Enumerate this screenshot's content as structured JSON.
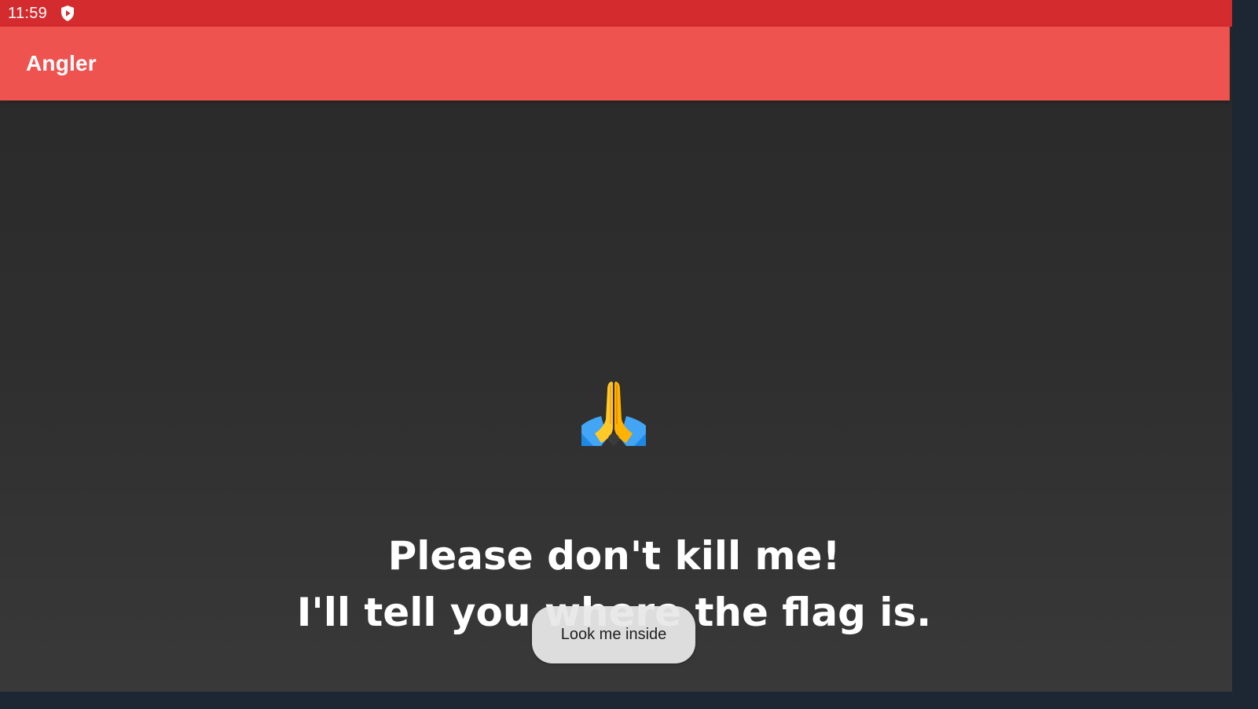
{
  "status_bar": {
    "time": "11:59",
    "notification_icon": "shield-play-icon"
  },
  "app_bar": {
    "title": "Angler"
  },
  "main": {
    "emoji": "folded-hands-emoji",
    "message_line1": "Please don't kill me!",
    "message_line2": "I'll tell you where the flag is.",
    "button_label": "Look me inside"
  },
  "colors": {
    "status_bar": "#d42b2e",
    "app_bar": "#ef5350",
    "background_top": "#292929",
    "background_bottom": "#393939",
    "button_bg": "#e8e8e8"
  }
}
